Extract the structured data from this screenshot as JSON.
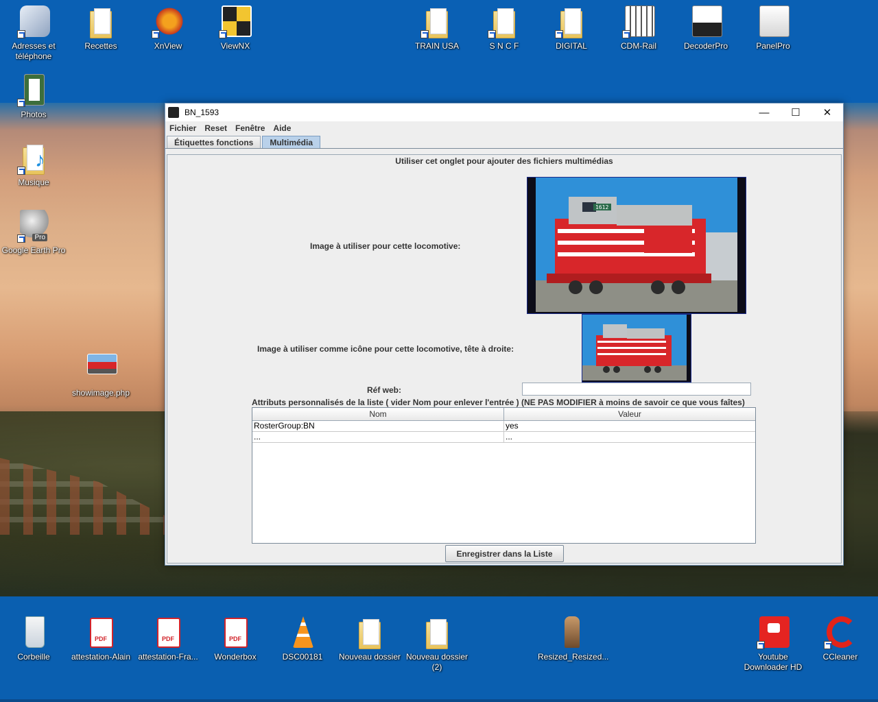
{
  "desktop_icons_top": [
    {
      "label": "Adresses et téléphone",
      "icon": "address-book-icon"
    },
    {
      "label": "Recettes",
      "icon": "folder-icon"
    },
    {
      "label": "XnView",
      "icon": "xnview-icon"
    },
    {
      "label": "ViewNX",
      "icon": "viewnx-icon"
    },
    {
      "label": "TRAIN USA",
      "icon": "folder-icon"
    },
    {
      "label": "S N C F",
      "icon": "folder-icon"
    },
    {
      "label": "DIGITAL",
      "icon": "folder-icon"
    },
    {
      "label": "CDM-Rail",
      "icon": "cdm-rail-icon"
    },
    {
      "label": "DecoderPro",
      "icon": "decoderpro-icon"
    },
    {
      "label": "PanelPro",
      "icon": "panelpro-icon"
    }
  ],
  "desktop_icons_left": [
    {
      "label": "Photos",
      "icon": "photos-icon"
    },
    {
      "label": "Musique",
      "icon": "music-folder-icon"
    },
    {
      "label": "Google Earth Pro",
      "icon": "google-earth-icon",
      "badge": "Pro"
    },
    {
      "label": "showimage.php",
      "icon": "image-file-icon"
    }
  ],
  "desktop_icons_bottom": [
    {
      "label": "Corbeille",
      "icon": "recycle-bin-icon"
    },
    {
      "label": "attestation-Alain",
      "icon": "pdf-icon"
    },
    {
      "label": "attestation-Fra...",
      "icon": "pdf-icon"
    },
    {
      "label": "Wonderbox",
      "icon": "pdf-icon"
    },
    {
      "label": "DSC00181",
      "icon": "vlc-icon"
    },
    {
      "label": "Nouveau dossier",
      "icon": "folder-icon"
    },
    {
      "label": "Nouveau dossier (2)",
      "icon": "folder-icon"
    },
    {
      "label": "Resized_Resized...",
      "icon": "image-file-icon"
    },
    {
      "label": "Youtube Downloader HD",
      "icon": "youtube-downloader-icon"
    },
    {
      "label": "CCleaner",
      "icon": "ccleaner-icon"
    }
  ],
  "pdf_badge": "PDF",
  "window": {
    "title": "BN_1593",
    "controls": {
      "minimize": "—",
      "maximize": "☐",
      "close": "✕"
    },
    "menu": [
      "Fichier",
      "Reset",
      "Fenêtre",
      "Aide"
    ],
    "tabs": [
      {
        "label": "Étiquettes fonctions",
        "active": false
      },
      {
        "label": "Multimédia",
        "active": true
      }
    ]
  },
  "multimedia": {
    "heading": "Utiliser cet onglet pour ajouter des fichiers multimédias",
    "image_label": "Image à utiliser pour cette locomotive:",
    "icon_label": "Image à utiliser comme icône pour cette locomotive, tête à droite:",
    "web_ref_label": "Réf web:",
    "web_ref_value": "",
    "attributes_label": "Attributs personnalisés de la liste ( vider Nom pour enlever l'entrée ) (NE PAS MODIFIER à moins de savoir ce que vous faîtes)",
    "table": {
      "columns": [
        "Nom",
        "Valeur"
      ],
      "rows": [
        [
          "RosterGroup:BN",
          "yes"
        ],
        [
          "...",
          "..."
        ]
      ]
    },
    "save_button": "Enregistrer dans la Liste",
    "loco_number": "1612"
  },
  "colors": {
    "desktop_blue": "#0a60b4",
    "tab_active": "#b9d1ea",
    "loco_red": "#d8262a"
  }
}
